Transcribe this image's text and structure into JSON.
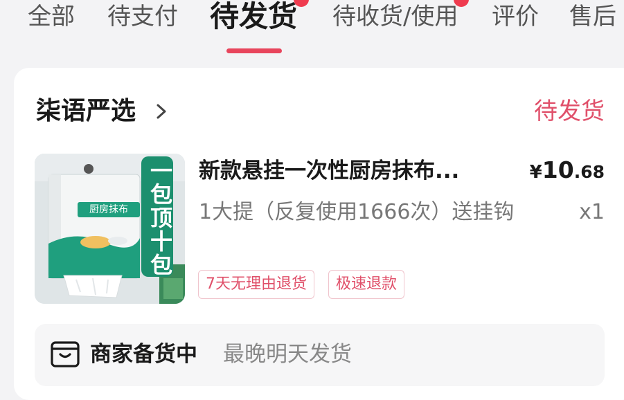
{
  "tabs": [
    {
      "label": "全部"
    },
    {
      "label": "待支付"
    },
    {
      "label": "待发货",
      "active": true
    },
    {
      "label": "待收货/使用"
    },
    {
      "label": "评价"
    },
    {
      "label": "售后"
    }
  ],
  "colors": {
    "accent": "#e8455c",
    "status_text": "#e0506a",
    "badge": "#ef3b4f"
  },
  "order": {
    "shop_name": "柒语严选",
    "status": "待发货",
    "product": {
      "title": "新款悬挂一次性厨房抹布...",
      "spec": "1大提（反复使用1666次）送挂钩",
      "price_currency": "¥",
      "price_integer": "10",
      "price_decimal": ".68",
      "quantity": "x1",
      "tags": [
        "7天无理由退货",
        "极速退款"
      ],
      "image": {
        "banner_text": "一包顶十包",
        "package_label": "厨房抹布"
      }
    },
    "notice": {
      "icon": "package-box-icon",
      "title": "商家备货中",
      "subtitle": "最晚明天发货"
    }
  }
}
